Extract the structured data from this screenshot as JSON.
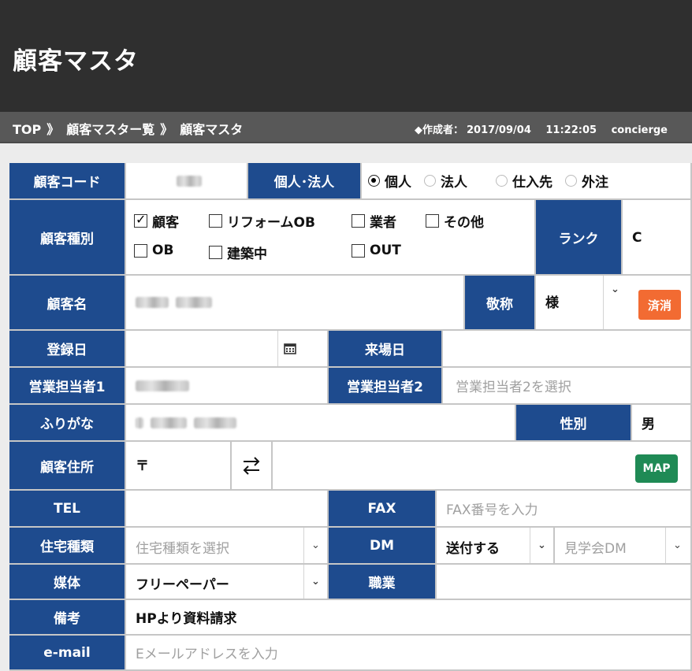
{
  "header": {
    "title": "顧客マスタ"
  },
  "breadcrumb": {
    "items": [
      "TOP",
      "顧客マスター覧",
      "顧客マスタ"
    ],
    "separator": "》",
    "creator_label": "◆作成者：",
    "created_date": "2017/09/04",
    "created_time": "11:22:05",
    "creator_name": "concierge"
  },
  "form": {
    "customer_code": {
      "label": "顧客コード"
    },
    "entity": {
      "label": "個人･法人",
      "options": [
        "個人",
        "法人",
        "仕入先",
        "外注"
      ],
      "selected": "個人"
    },
    "customer_type": {
      "label": "顧客種別",
      "options": [
        "顧客",
        "リフォームOB",
        "業者",
        "その他",
        "OB",
        "建築中",
        "OUT"
      ],
      "checked": [
        "顧客"
      ]
    },
    "rank": {
      "label": "ランク",
      "value": "C"
    },
    "customer_name": {
      "label": "顧客名"
    },
    "honorific": {
      "label": "敬称",
      "value": "様",
      "button": "済消"
    },
    "registration_date": {
      "label": "登録日"
    },
    "visit_date": {
      "label": "来場日"
    },
    "sales_rep1": {
      "label": "営業担当者1"
    },
    "sales_rep2": {
      "label": "営業担当者2",
      "placeholder": "営業担当者2を選択"
    },
    "furigana": {
      "label": "ふりがな"
    },
    "gender": {
      "label": "性別",
      "value": "男"
    },
    "address": {
      "label": "顧客住所",
      "postal_mark": "〒",
      "map_button": "MAP"
    },
    "tel": {
      "label": "TEL"
    },
    "fax": {
      "label": "FAX",
      "placeholder": "FAX番号を入力"
    },
    "housing_type": {
      "label": "住宅種類",
      "placeholder": "住宅種類を選択"
    },
    "dm": {
      "label": "DM",
      "value": "送付する",
      "secondary_placeholder": "見学会DM"
    },
    "media": {
      "label": "媒体",
      "value": "フリーペーパー"
    },
    "occupation": {
      "label": "職業"
    },
    "notes": {
      "label": "備考",
      "value": "HPより資料請求"
    },
    "email": {
      "label": "e-mail",
      "placeholder": "Eメールアドレスを入力"
    }
  },
  "colors": {
    "label_bg": "#1e4b8e",
    "header_bg": "#2f2f2f",
    "crumb_bg": "#585858",
    "orange": "#f26b32",
    "green": "#1f8a55"
  }
}
